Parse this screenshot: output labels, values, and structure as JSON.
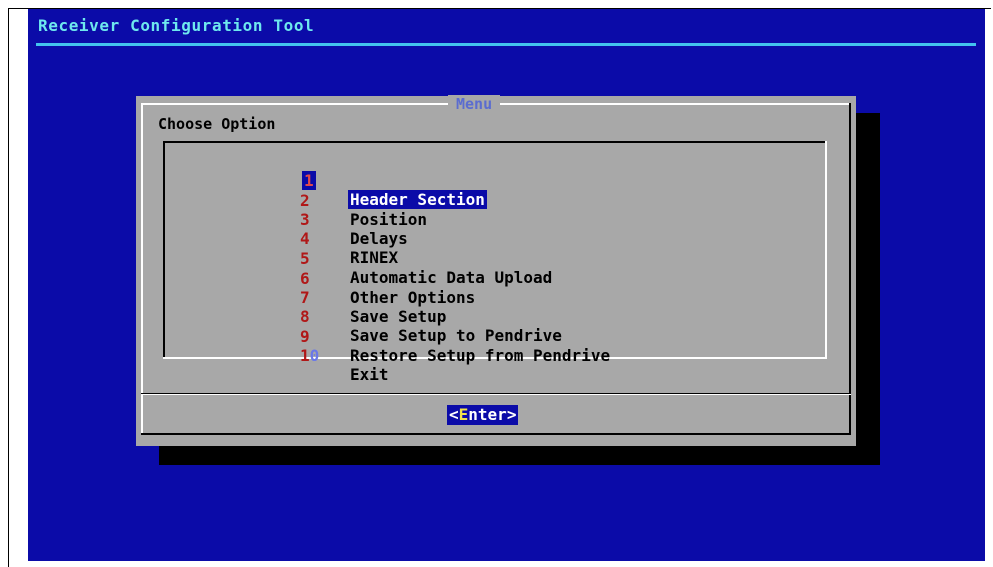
{
  "app": {
    "title": "Receiver Configuration Tool"
  },
  "dialog": {
    "title": "Menu",
    "prompt": "Choose Option",
    "items": [
      {
        "key": "1",
        "label": "Header Section",
        "selected": true
      },
      {
        "key": "2",
        "label": "Position",
        "selected": false
      },
      {
        "key": "3",
        "label": "Delays",
        "selected": false
      },
      {
        "key": "4",
        "label": "RINEX",
        "selected": false
      },
      {
        "key": "5",
        "label": "Automatic Data Upload",
        "selected": false
      },
      {
        "key": "6",
        "label": "Other Options",
        "selected": false
      },
      {
        "key": "7",
        "label": "Save Setup",
        "selected": false
      },
      {
        "key": "8",
        "label": "Save Setup to Pendrive",
        "selected": false
      },
      {
        "key": "9",
        "label": "Restore Setup from Pendrive",
        "selected": false
      },
      {
        "key_first": "1",
        "key_rest": "0",
        "label": "Exit",
        "selected": false
      }
    ],
    "buttons": {
      "enter_open": "<",
      "enter_hotkey": "E",
      "enter_rest": "nter",
      "enter_close": ">"
    }
  },
  "colors": {
    "background": "#0b0ba8",
    "dialog": "#a8a8a8",
    "title_text": "#6ee8ee",
    "menu_title": "#5b6cd0",
    "hotkey": "#b01818",
    "selection": "#0b0ba8"
  }
}
